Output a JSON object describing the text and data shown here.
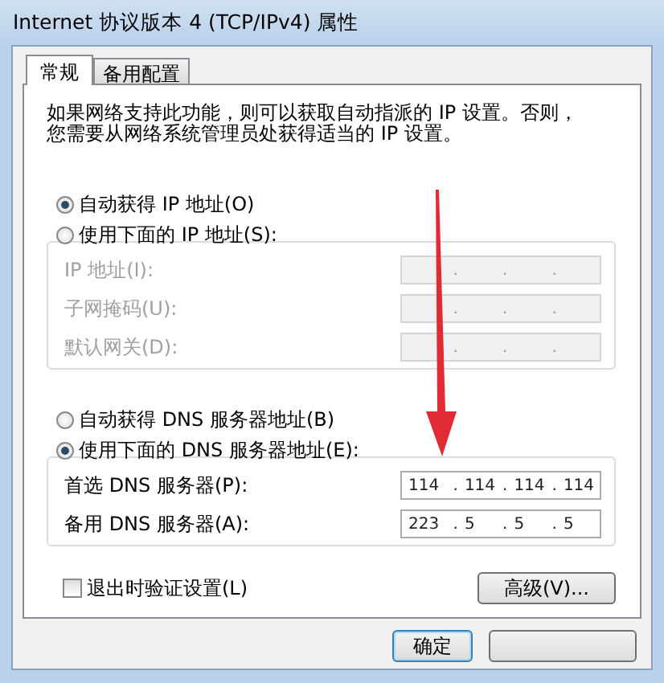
{
  "window": {
    "title": "Internet 协议版本 4 (TCP/IPv4) 属性"
  },
  "tabs": [
    {
      "label": "常规",
      "selected": true
    },
    {
      "label": "备用配置",
      "selected": false
    }
  ],
  "description": {
    "lines": [
      "如果网络支持此功能，则可以获取自动指派的 IP 设置。否则，",
      "您需要从网络系统管理员处获得适当的 IP 设置。"
    ]
  },
  "ip_separator": ".",
  "ip_section": {
    "options": [
      {
        "label": "自动获得 IP 地址(O)",
        "selected": true
      },
      {
        "label": "使用下面的 IP 地址(S):",
        "selected": false
      }
    ],
    "fields": [
      {
        "label": "IP 地址(I):",
        "disabled": true
      },
      {
        "label": "子网掩码(U):",
        "disabled": true
      },
      {
        "label": "默认网关(D):",
        "disabled": true
      }
    ]
  },
  "dns_section": {
    "options": [
      {
        "label": "自动获得 DNS 服务器地址(B)",
        "selected": false
      },
      {
        "label": "使用下面的 DNS 服务器地址(E):",
        "selected": true
      }
    ],
    "fields": [
      {
        "label": "首选 DNS 服务器(P):",
        "disabled": false,
        "octets": [
          "114",
          "114",
          "114",
          "114"
        ]
      },
      {
        "label": "备用 DNS 服务器(A):",
        "disabled": false,
        "octets": [
          "223",
          "5",
          "5",
          "5"
        ]
      }
    ]
  },
  "validate_on_exit": {
    "label": "退出时验证设置(L)",
    "checked": false
  },
  "advanced_button": "高级(V)...",
  "ok_button": "确定"
}
